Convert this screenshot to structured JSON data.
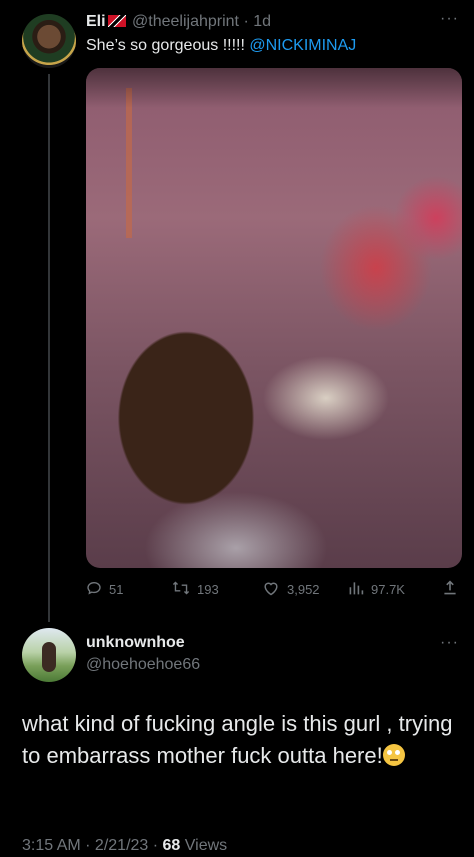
{
  "parent_tweet": {
    "display_name": "Eli",
    "handle": "@theelijahprint",
    "time": "1d",
    "flag_icon": "trinidad-and-tobago-flag-icon",
    "text": "She’s so gorgeous !!!!! ",
    "mention": "@NICKIMINAJ",
    "more_icon": "more-dots-icon",
    "stats": {
      "replies": "51",
      "retweets": "193",
      "likes": "3,952",
      "views": "97.7K"
    },
    "action_icons": [
      "reply-icon",
      "retweet-icon",
      "like-icon",
      "views-icon",
      "share-icon"
    ]
  },
  "reply_tweet": {
    "display_name": "unknownhoe",
    "handle": "@hoehoehoe66",
    "more_icon": "more-dots-icon",
    "text": "what kind of fucking angle is this gurl , trying to embarrass mother fuck outta here!",
    "emoji": "face-with-rolling-eyes",
    "timestamp": "3:15 AM · 2/21/23 · ",
    "views_count": "68",
    "views_label": "Views"
  },
  "colors": {
    "background": "#000000",
    "text": "#e7e9ea",
    "muted": "#71767b",
    "accent": "#1d9bf0"
  }
}
